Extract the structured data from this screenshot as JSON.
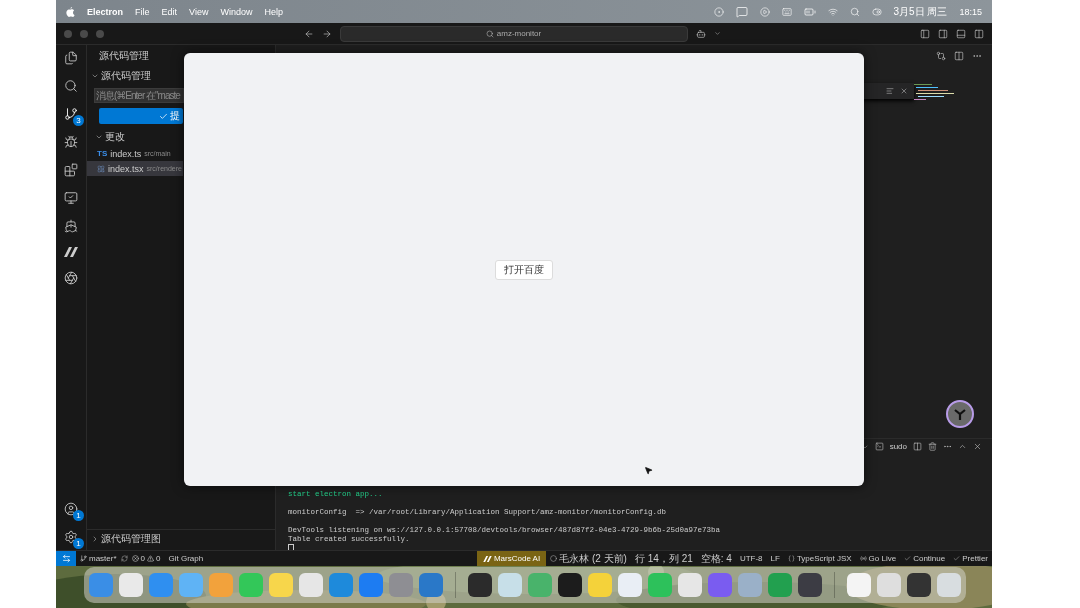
{
  "menu_bar": {
    "app": "Electron",
    "menus": [
      "File",
      "Edit",
      "View",
      "Window",
      "Help"
    ],
    "date": "3月5日 周三",
    "time": "18:15"
  },
  "title_bar": {
    "search": "amz-monitor"
  },
  "activity_bar": {
    "scm_badge": "3",
    "accounts_badge": "1",
    "settings_badge": "1"
  },
  "sidebar": {
    "title": "源代码管理",
    "section": {
      "label": "源代码管理",
      "expanded": true
    },
    "message_placeholder": "消息(⌘Enter 在\"maste",
    "commit_label": "提",
    "changes": {
      "label": "更改",
      "expanded": true,
      "files": [
        {
          "kind": "ts",
          "badge": "TS",
          "name": "index.ts",
          "path": "src/main",
          "selected": false
        },
        {
          "kind": "react",
          "name": "index.tsx",
          "path": "src/rendere",
          "selected": true
        }
      ]
    },
    "graph_section": {
      "label": "源代码管理图",
      "expanded": false
    }
  },
  "terminal": {
    "shell": "sudo",
    "lines": [
      {
        "kind": "success",
        "text": "start electron app..."
      },
      {
        "kind": "blank"
      },
      {
        "kind": "plain",
        "text": "monitorConfig  => /var/root/Library/Application Support/amz-monitor/monitorConfig.db"
      },
      {
        "kind": "blank"
      },
      {
        "kind": "plain",
        "text": "DevTools listening on ws://127.0.0.1:57708/devtools/browser/487d87f2-04e3-4729-9b6b-25d0a97e73ba"
      },
      {
        "kind": "plain",
        "text": "Table created successfully."
      }
    ]
  },
  "status_bar": {
    "branch": "master*",
    "errors": "0",
    "warnings": "0",
    "git_graph": "Git Graph",
    "ai": "MarsCode AI",
    "items": [
      {
        "kind": "blame",
        "text": "毛永林 (2 天前)"
      },
      {
        "kind": "plain",
        "text": "行 14，列 21"
      },
      {
        "kind": "plain",
        "text": "空格: 4"
      },
      {
        "kind": "plain",
        "text": "UTF-8"
      },
      {
        "kind": "plain",
        "text": "LF"
      },
      {
        "kind": "language",
        "text": "TypeScript JSX"
      },
      {
        "kind": "live",
        "text": "Go Live"
      },
      {
        "kind": "check",
        "text": "Continue"
      },
      {
        "kind": "check",
        "text": "Prettier"
      }
    ]
  },
  "electron_window": {
    "button": "打开百度"
  }
}
